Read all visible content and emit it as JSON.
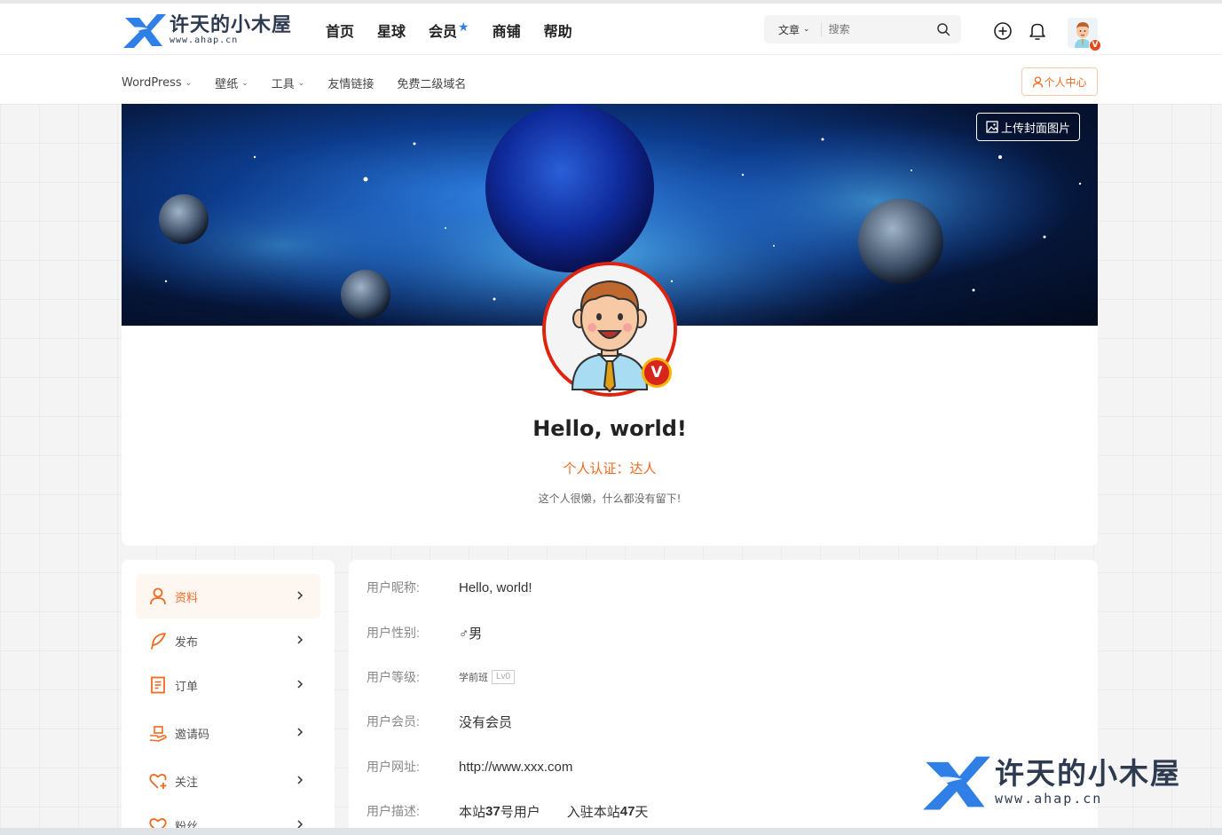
{
  "site": {
    "logo_title": "许天的小木屋",
    "logo_sub": "www.ahap.cn"
  },
  "main_nav": [
    {
      "label": "首页"
    },
    {
      "label": "星球"
    },
    {
      "label": "会员"
    },
    {
      "label": "商铺"
    },
    {
      "label": "帮助"
    }
  ],
  "search": {
    "category": "文章",
    "placeholder": "搜索"
  },
  "sub_nav": [
    {
      "label": "WordPress",
      "has_dropdown": true
    },
    {
      "label": "壁纸",
      "has_dropdown": true
    },
    {
      "label": "工具",
      "has_dropdown": true
    },
    {
      "label": "友情链接",
      "has_dropdown": false
    },
    {
      "label": "免费二级域名",
      "has_dropdown": false
    }
  ],
  "user_center_label": "个人中心",
  "cover": {
    "upload_label": "上传封面图片"
  },
  "profile": {
    "name": "Hello, world!",
    "certification": "个人认证：达人",
    "description": "这个人很懒，什么都没有留下!",
    "badge": "V"
  },
  "side_menu": [
    {
      "label": "资料",
      "icon": "user-icon",
      "active": true
    },
    {
      "label": "发布",
      "icon": "feather-icon",
      "active": false
    },
    {
      "label": "订单",
      "icon": "order-icon",
      "active": false
    },
    {
      "label": "邀请码",
      "icon": "invite-icon",
      "active": false
    },
    {
      "label": "关注",
      "icon": "heart-plus-icon",
      "active": false
    },
    {
      "label": "粉丝",
      "icon": "fans-icon",
      "active": false
    }
  ],
  "info": {
    "nickname_label": "用户昵称:",
    "nickname": "Hello, world!",
    "gender_label": "用户性别:",
    "gender": "♂男",
    "level_label": "用户等级:",
    "level_name": "学前班",
    "level_tag": "Lv0",
    "vip_label": "用户会员:",
    "vip": "没有会员",
    "url_label": "用户网址:",
    "url": "http://www.xxx.com",
    "desc_label": "用户描述:",
    "user_no_prefix": "本站",
    "user_no": "37",
    "user_no_suffix": "号用户",
    "days_prefix": "入驻本站",
    "days": "47",
    "days_suffix": "天"
  },
  "colors": {
    "accent": "#f06a21",
    "brand_blue": "#2f7fe6",
    "badge_red": "#d7251b"
  }
}
